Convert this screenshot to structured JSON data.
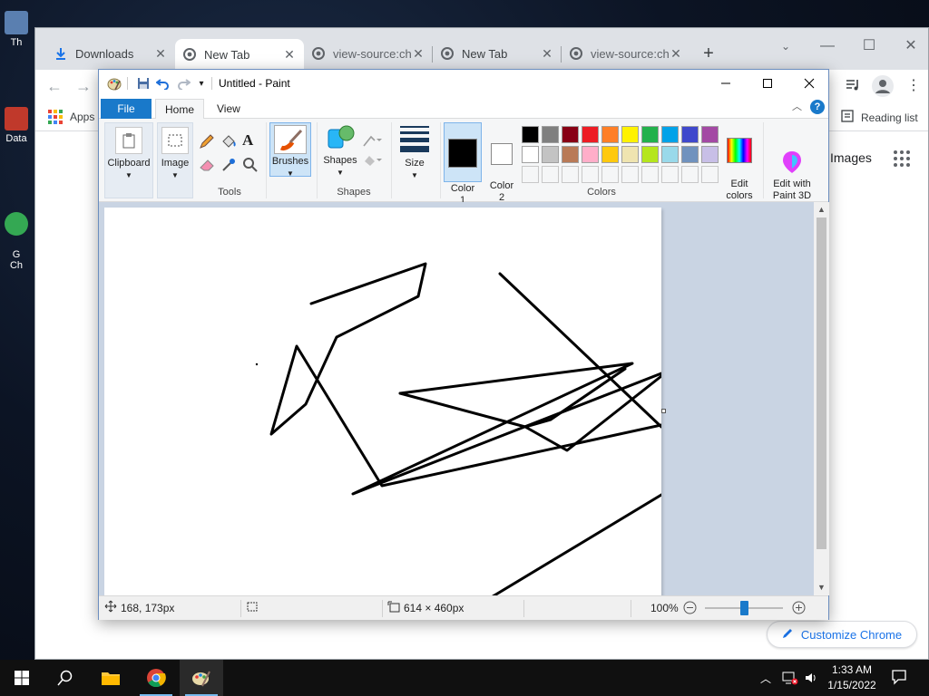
{
  "desktop": {
    "icons": [
      {
        "label": "Th",
        "color": "#5a7fb0"
      },
      {
        "label": "Data",
        "color": "#c0392b"
      },
      {
        "label": "G\nCh",
        "color": "#34a853"
      }
    ]
  },
  "chrome": {
    "tabs": [
      {
        "label": "Downloads",
        "icon": "download-icon",
        "active": false
      },
      {
        "label": "New Tab",
        "icon": "chrome-icon",
        "active": true
      },
      {
        "label": "view-source:ch",
        "icon": "chrome-icon",
        "active": false
      },
      {
        "label": "New Tab",
        "icon": "chrome-icon",
        "active": false
      },
      {
        "label": "view-source:ch",
        "icon": "chrome-icon",
        "active": false
      }
    ],
    "new_tab_symbol": "+",
    "bookmarks": {
      "apps_label": "Apps",
      "reading_list_label": "Reading list"
    },
    "ntp": {
      "images_label": "Images",
      "customize_label": "Customize Chrome"
    }
  },
  "paint": {
    "title": "Untitled - Paint",
    "tabs": {
      "file": "File",
      "home": "Home",
      "view": "View"
    },
    "ribbon": {
      "clipboard": "Clipboard",
      "image": "Image",
      "tools_group": "Tools",
      "brushes": "Brushes",
      "shapes": "Shapes",
      "shapes_group": "Shapes",
      "size": "Size",
      "color1": "Color\n1",
      "color2": "Color\n2",
      "edit_colors": "Edit\ncolors",
      "paint3d": "Edit with\nPaint 3D",
      "colors_group": "Colors"
    },
    "active_color1": "#000000",
    "active_color2": "#ffffff",
    "palette_row1": [
      "#000000",
      "#7f7f7f",
      "#880015",
      "#ed1c24",
      "#ff7f27",
      "#fff200",
      "#22b14c",
      "#00a2e8",
      "#3f48cc",
      "#a349a4"
    ],
    "palette_row2": [
      "#ffffff",
      "#c3c3c3",
      "#b97a57",
      "#ffaec9",
      "#ffc90e",
      "#efe4b0",
      "#b5e61d",
      "#99d9ea",
      "#7092be",
      "#c8bfe7"
    ],
    "status": {
      "cursor_pos": "168, 173px",
      "canvas_size": "614 × 460px",
      "zoom": "100%"
    },
    "zoom_slider_fraction": 0.5
  },
  "taskbar": {
    "time": "1:33 AM",
    "date": "1/15/2022"
  }
}
